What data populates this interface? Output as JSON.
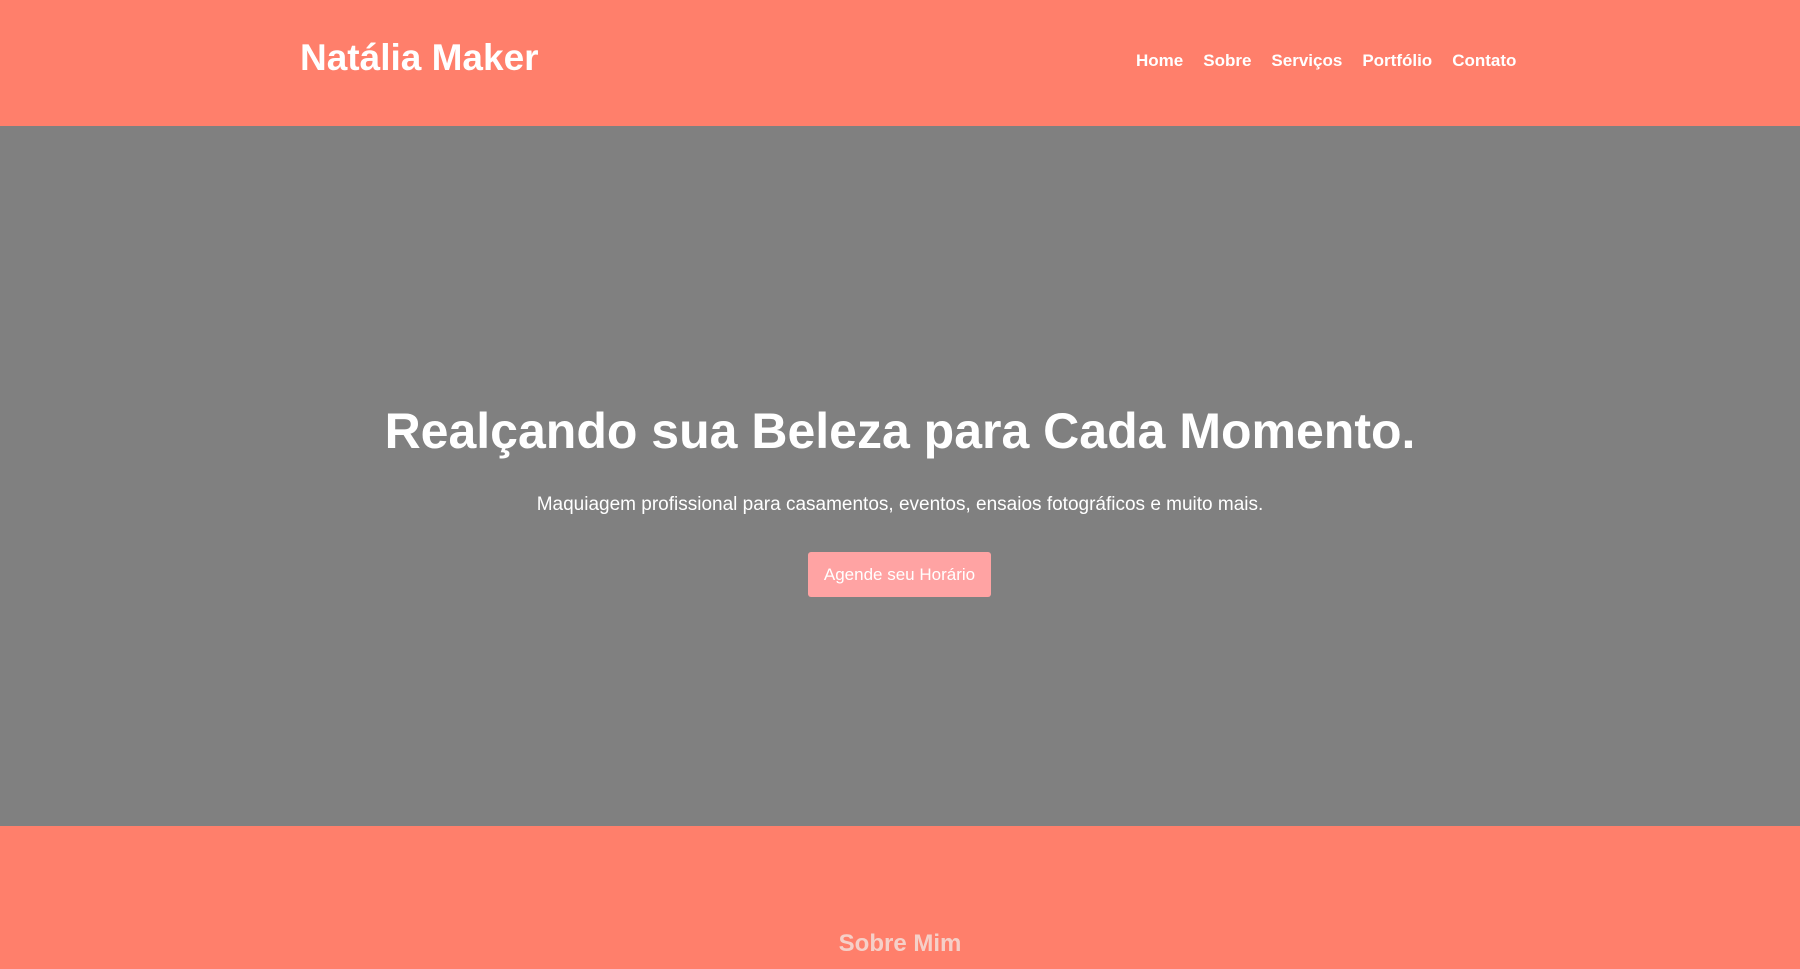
{
  "header": {
    "brand": "Natália Maker",
    "nav": [
      "Home",
      "Sobre",
      "Serviços",
      "Portfólio",
      "Contato"
    ]
  },
  "hero": {
    "title": "Realçando sua Beleza para Cada Momento.",
    "subtitle": "Maquiagem profissional para casamentos, eventos, ensaios fotográficos e muito mais.",
    "cta_label": "Agende seu Horário"
  },
  "about": {
    "title": "Sobre Mim"
  },
  "colors": {
    "brand_coral": "#ff7f6b",
    "hero_overlay": "#808080",
    "cta_pink": "#ffa3a3",
    "text_white": "#ffffff"
  }
}
